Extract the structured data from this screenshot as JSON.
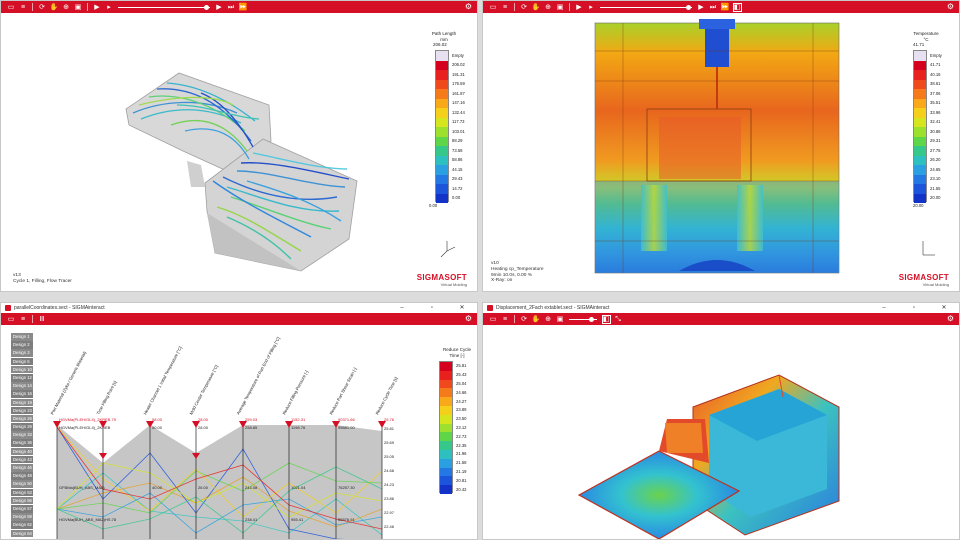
{
  "colors": {
    "brand_red": "#d50f25"
  },
  "toolbar_icons": [
    "folder-icon",
    "list-icon",
    "sync-icon",
    "hand-icon",
    "zoom-icon",
    "image-icon",
    "play-icon",
    "step-back-icon",
    "step-forward-icon",
    "fast-forward-icon",
    "gear-icon"
  ],
  "top_left": {
    "legend": {
      "title1": "Path Length",
      "title2": "mm",
      "max_label": "206.02",
      "empty_label": "Empty",
      "ticks": [
        "206.02",
        "191.31",
        "176.59",
        "161.87",
        "147.16",
        "132.44",
        "117.73",
        "103.01",
        "88.29",
        "73.58",
        "58.86",
        "44.15",
        "29.43",
        "14.72",
        "0.00"
      ],
      "min_label": "0.00"
    },
    "info": [
      "v13",
      "Cycle 1, Filling, Flow Tracer"
    ],
    "brand": {
      "name": "SIGMASOFT",
      "tagline": "Virtual Molding"
    },
    "axes": {
      "x": "x",
      "y": "y",
      "z": "z"
    }
  },
  "top_right": {
    "legend": {
      "title1": "Temperature",
      "title2": "°C",
      "max_label": "41.71",
      "empty_label": "Empty",
      "ticks": [
        "41.71",
        "40.16",
        "38.61",
        "37.06",
        "35.51",
        "33.96",
        "32.41",
        "30.86",
        "29.31",
        "27.75",
        "26.20",
        "24.65",
        "23.10",
        "21.55",
        "20.00"
      ],
      "min_label": "20.00"
    },
    "info": [
      "v10",
      "Heating cp_Temperature",
      "9min 10.0s, 0.00 %",
      "X-Ray: on"
    ],
    "brand": {
      "name": "SIGMASOFT",
      "tagline": "Virtual Molding"
    },
    "axes": {
      "x": "x",
      "z": "z"
    }
  },
  "bottom_left": {
    "title": "parallelCoordinates.sect - SIGMAinteract",
    "designs": [
      "Design 1",
      "Design 2",
      "Design 3",
      "Design 5",
      "Design 10",
      "Design 12",
      "Design 14",
      "Design 16",
      "Design 19",
      "Design 23",
      "Design 26",
      "Design 29",
      "Design 33",
      "Design 36",
      "Design 40",
      "Design 43",
      "Design 46",
      "Design 48",
      "Design 50",
      "Design 53",
      "Design 56",
      "Design 57",
      "Design 59",
      "Design 62",
      "Design 64"
    ],
    "legend": {
      "title1": "Reduce Cycle",
      "title2": "Time [-]",
      "ticks": [
        "25.81",
        "25.43",
        "25.04",
        "24.66",
        "24.27",
        "23.89",
        "23.50",
        "23.12",
        "22.73",
        "22.35",
        "21.96",
        "21.58",
        "21.19",
        "20.81",
        "20.42"
      ]
    },
    "axes": [
      {
        "label": "Part Material (Zyka / Generic Material)",
        "top": "HGVMa(PLEH/GL4)_2KREB.79",
        "mid": "HGVMa(PLEH/GL4)_2KREB",
        "low": "GFBMa(BUH_ABS_MA2)",
        "low2": "HGVMa(BUH_ABS_MA2)HS.78"
      },
      {
        "label": "Time Filling Point [s]",
        "top": "",
        "mid": ""
      },
      {
        "label": "Heater Channel 1 Initial Temperature [°C]",
        "top": "58.00",
        "mid": "50.00",
        "low": "40.00"
      },
      {
        "label": "Mold Center Temperature [°C]",
        "top": "28.00",
        "mid": "28.00",
        "low": "26.00"
      },
      {
        "label": "Average Temperature of Part End of Filling [°C]",
        "top": "259.03",
        "mid": "258.85",
        "low": "244.08",
        "low2": "238.41"
      },
      {
        "label": "Reduce Filling Pressure [-]",
        "top": "1152.31",
        "mid": "1198.76",
        "low": "1021.04",
        "low2": "955.41"
      },
      {
        "label": "Reduce Part Shear Strain [-]",
        "top": "90371.66",
        "mid": "95681.00",
        "low": "76257.30",
        "low2": "55576.91"
      },
      {
        "label": "Reduce Cycle Time [s]",
        "top": "25.76",
        "ticks": [
          "25.81",
          "25.69",
          "25.05",
          "24.68",
          "24.23",
          "23.86",
          "22.97",
          "22.46"
        ]
      }
    ]
  },
  "bottom_right": {
    "title": "Displacement_2Fach extablet.sect - SIGMAinteract"
  }
}
